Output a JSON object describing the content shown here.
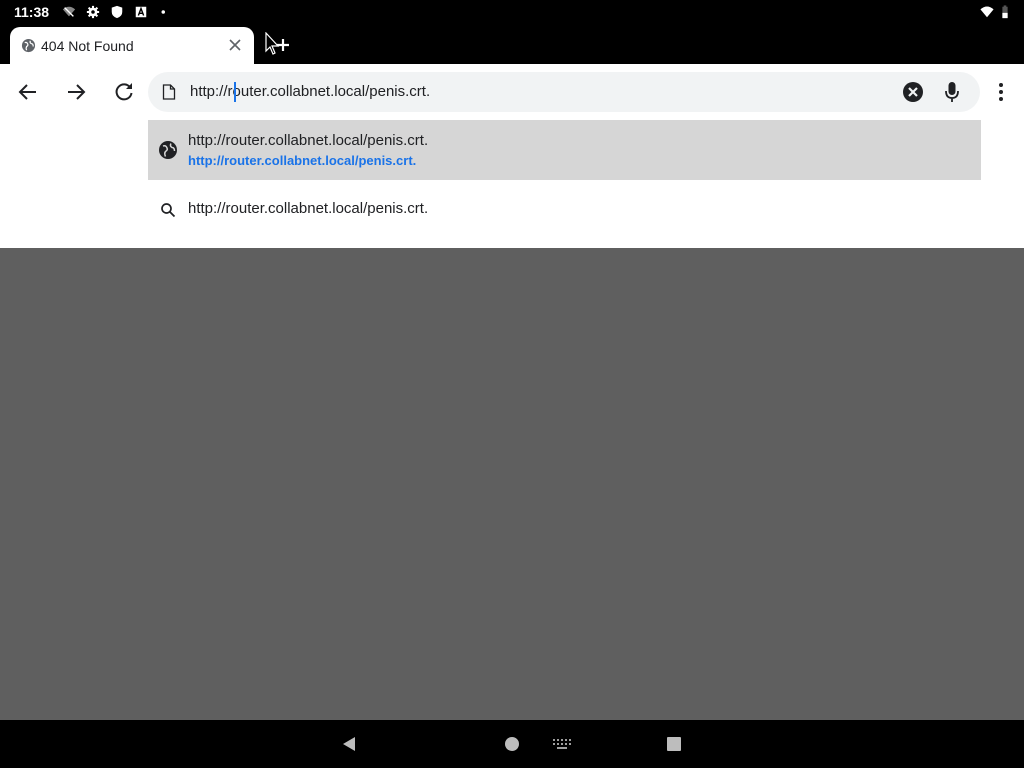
{
  "status_bar": {
    "time": "11:38"
  },
  "tab": {
    "title": "404 Not Found"
  },
  "omnibox": {
    "url": "http://router.collabnet.local/penis.crt."
  },
  "suggestions": [
    {
      "title": "http://router.collabnet.local/penis.crt.",
      "url": "http://router.collabnet.local/penis.crt.",
      "icon": "globe-icon"
    },
    {
      "title": "http://router.collabnet.local/penis.crt.",
      "icon": "search-icon"
    }
  ],
  "colors": {
    "accent": "#1a73e8",
    "page_background": "#5f5f5f",
    "selected_suggestion": "#d6d6d6"
  }
}
